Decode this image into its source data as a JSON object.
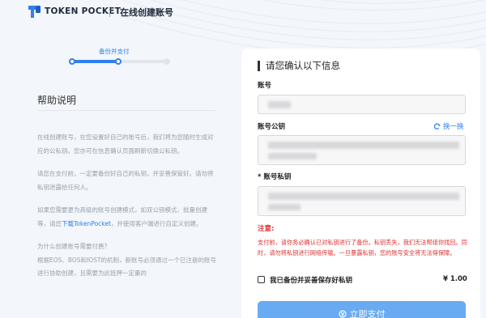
{
  "header": {
    "brand": "TOKEN POCKET",
    "title": "在线创建账号"
  },
  "stepper": {
    "label": "备份并支付",
    "progress": 0.5
  },
  "help": {
    "title": "帮助说明",
    "p1": "在线创建账号，在您设置好自己的账号后，我们将为您随时生成对应的公私钥。您亦可在信息确认页面刷新切换公私钥。",
    "p2": "请您在支付前，一定要备份好自己的私钥，并妥善保管好。请勿将私钥泄露给任何人。",
    "p3_before": "如果您需要更为高级的账号创建模式，如双公钥模式、批量创建等，请您",
    "p3_link": "下载TokenPocket",
    "p3_after": "，并使用客户端进行自定义创建。",
    "q": "为什么创建账号需要付费？",
    "p4": "根据EOS、BOS和IOST的机制，新账号必须通过一个已注册的账号进行协助创建，且需要为此抵押一定量的"
  },
  "panel": {
    "title": "请您确认以下信息",
    "account_label": "账号",
    "pubkey_label": "账号公钥",
    "swap_label": "换一换",
    "privkey_req": "*",
    "privkey_label": "账号私钥",
    "warn_label": "注意:",
    "warn_text": "支付前，请你务必确认已对私钥进行了备份。私钥丢失，我们无法帮组你找回。同时，请勿将私钥进行网络传输。一旦暴露私钥，您的账号安全将无法得保障。",
    "backup_label": "我已备份并妥善保存好私钥",
    "price": "¥ 1.00",
    "pay_label": "立即支付"
  },
  "colors": {
    "accent": "#2f80ed",
    "warning": "#e03131",
    "button": "#4f9cf0"
  },
  "icons": {
    "logo": "tokenpocket-logo-icon",
    "swap": "refresh-icon",
    "pay": "pay-icon"
  }
}
